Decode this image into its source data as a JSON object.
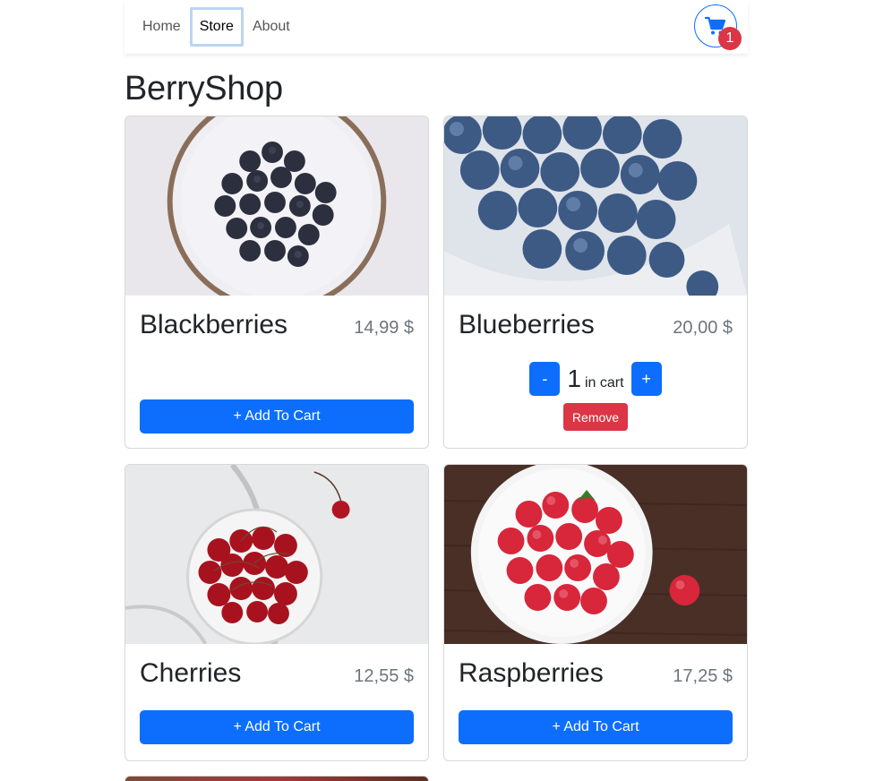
{
  "nav": {
    "home": "Home",
    "store": "Store",
    "about": "About",
    "cart_count": "1"
  },
  "page": {
    "title": "BerryShop"
  },
  "products": [
    {
      "name": "Blackberries",
      "price": "14,99 $",
      "add_label": "+ Add To Cart"
    },
    {
      "name": "Blueberries",
      "price": "20,00 $",
      "qty": "1",
      "qty_label": "in cart",
      "minus": "-",
      "plus": "+",
      "remove_label": "Remove"
    },
    {
      "name": "Cherries",
      "price": "12,55 $",
      "add_label": "+ Add To Cart"
    },
    {
      "name": "Raspberries",
      "price": "17,25 $",
      "add_label": "+ Add To Cart"
    }
  ],
  "colors": {
    "primary": "#0d6efd",
    "danger": "#dc3545",
    "text": "#212529",
    "muted": "#6c757d"
  },
  "icons": {
    "cart": "shopping-cart-icon"
  }
}
